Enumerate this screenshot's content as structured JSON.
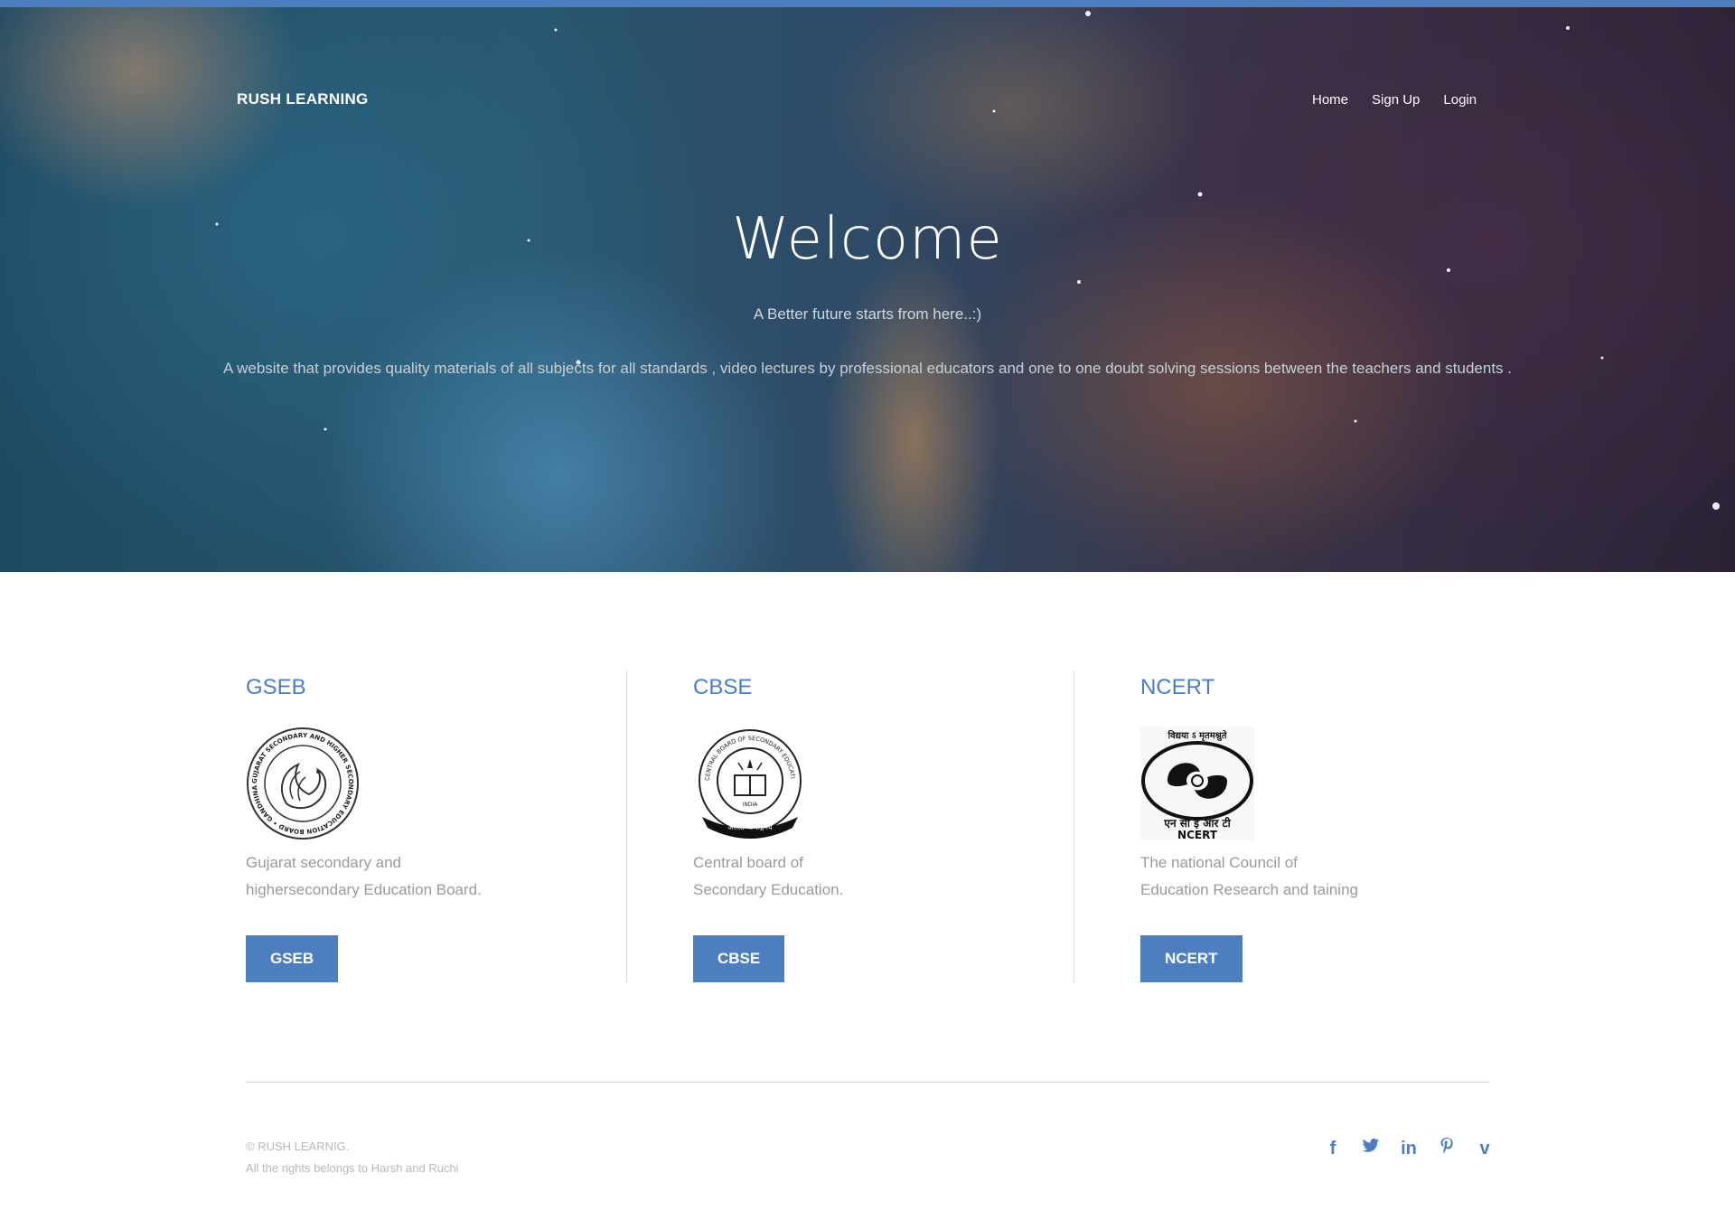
{
  "brand": "RUSH LEARNING",
  "nav": {
    "items": [
      "Home",
      "Sign Up",
      "Login"
    ]
  },
  "hero": {
    "title": "Welcome",
    "subtitle": "A Better future starts from here..:)",
    "description": "A website that provides quality materials of all subjects for all standards , video lectures by professional educators and one to one doubt solving sessions between the teachers and students ."
  },
  "boards": [
    {
      "title": "GSEB",
      "logo_icon": "gseb-emblem-icon",
      "desc_line1": "Gujarat secondary and",
      "desc_line2": "highersecondary Education Board.",
      "button": "GSEB"
    },
    {
      "title": "CBSE",
      "logo_icon": "cbse-emblem-icon",
      "desc_line1": "Central board of",
      "desc_line2": "Secondary Education.",
      "button": "CBSE"
    },
    {
      "title": "NCERT",
      "logo_icon": "ncert-emblem-icon",
      "desc_line1": "The national Council of",
      "desc_line2": "Education Research and taining",
      "button": "NCERT"
    }
  ],
  "logo_text": {
    "gseb": "GUJARAT SECONDARY AND HIGHER SECONDARY EDUCATION BOARD • GANDHINAGAR • STATE",
    "cbse": "CENTRAL BOARD OF SECONDARY EDUCATION",
    "cbse_country": "INDIA",
    "cbse_motto": "असतो मा सद्गमय",
    "ncert_top": "विद्यया ऽ मृतमश्नुते",
    "ncert_hindi": "एन सी ई आर टी",
    "ncert_en": "NCERT"
  },
  "footer": {
    "copyright": "© RUSH LEARNIG.",
    "rights": "All the rights belongs to Harsh and Ruchi",
    "social": [
      "facebook-icon",
      "twitter-icon",
      "linkedin-icon",
      "pinterest-icon",
      "vimeo-icon"
    ]
  },
  "colors": {
    "accent": "#4d7fc0",
    "muted_text": "#9a9a9a"
  }
}
